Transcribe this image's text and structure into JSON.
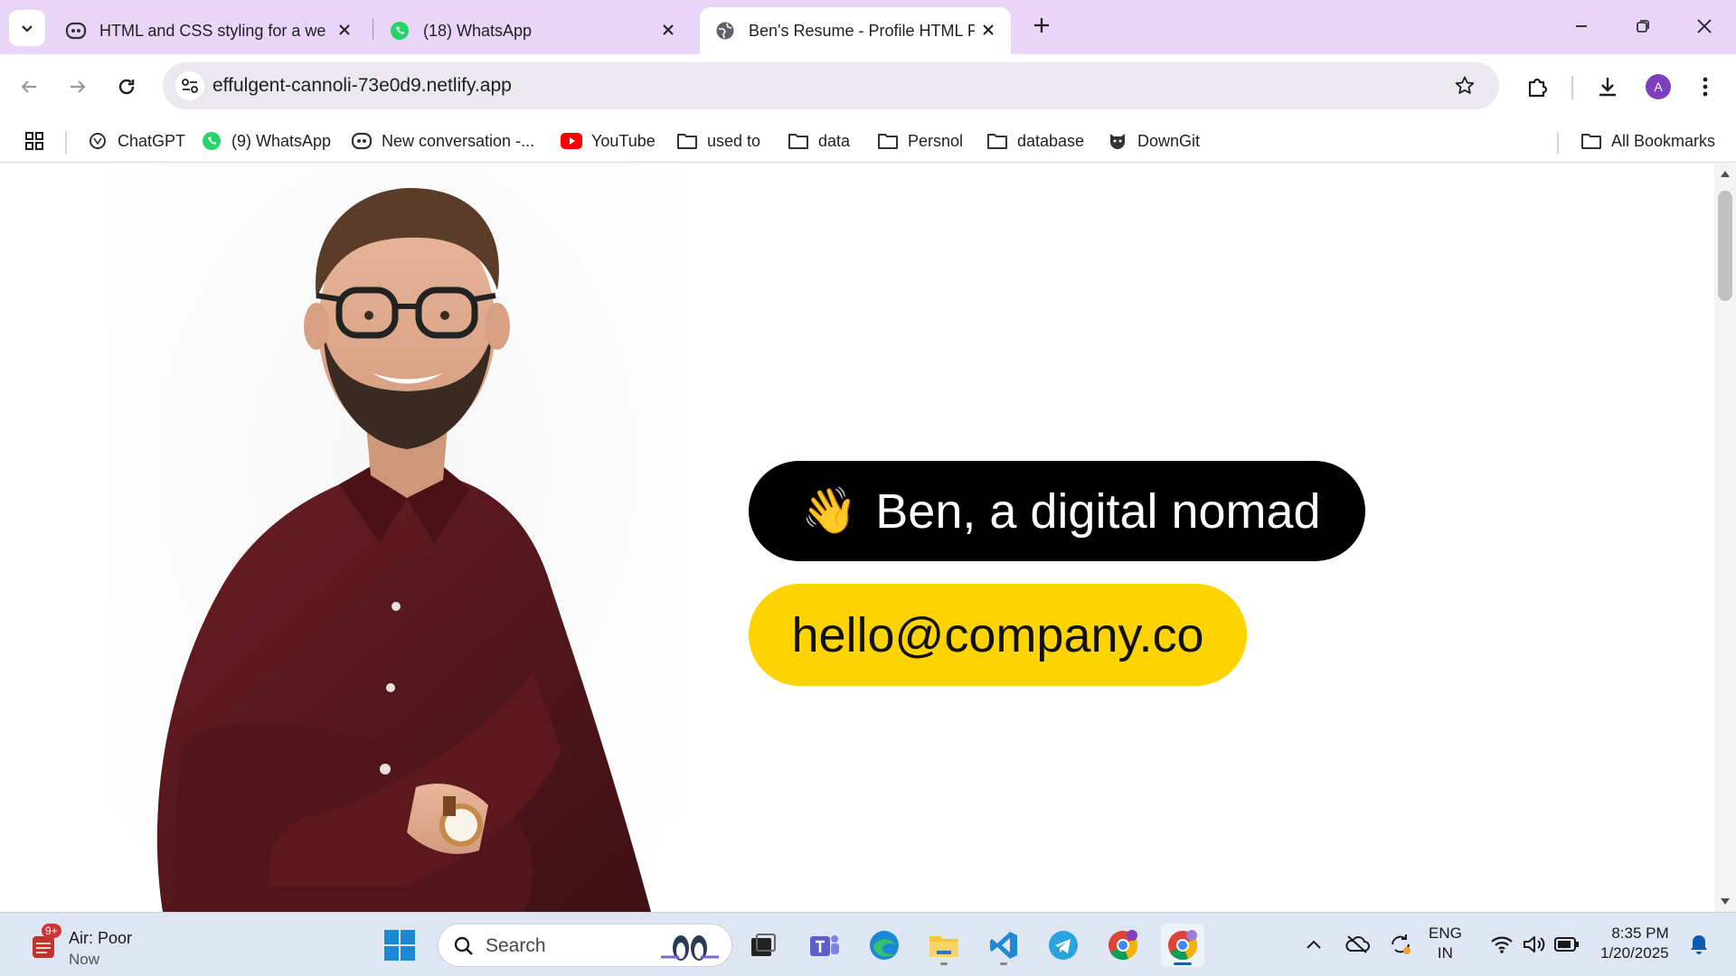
{
  "tabs": [
    {
      "title": "HTML and CSS styling for a web",
      "icon": "copilot-icon"
    },
    {
      "title": "(18) WhatsApp",
      "icon": "whatsapp-icon"
    },
    {
      "title": "Ben's Resume - Profile HTML Pa",
      "icon": "globe-icon",
      "active": true
    }
  ],
  "toolbar": {
    "url": "effulgent-cannoli-73e0d9.netlify.app",
    "avatar_initial": "A"
  },
  "bookmarks": {
    "items": [
      {
        "label": "ChatGPT",
        "icon": "chatgpt-icon"
      },
      {
        "label": "(9) WhatsApp",
        "icon": "whatsapp-icon"
      },
      {
        "label": "New conversation -...",
        "icon": "copilot-icon"
      },
      {
        "label": "YouTube",
        "icon": "youtube-icon"
      },
      {
        "label": "used to",
        "icon": "folder-icon"
      },
      {
        "label": "data",
        "icon": "folder-icon"
      },
      {
        "label": "Persnol",
        "icon": "folder-icon"
      },
      {
        "label": "database",
        "icon": "folder-icon"
      },
      {
        "label": "DownGit",
        "icon": "downgit-icon"
      }
    ],
    "all_bookmarks": "All Bookmarks"
  },
  "page": {
    "greeting_emoji": "👋",
    "name_line": "Ben, a digital nomad",
    "email": "hello@company.co",
    "colors": {
      "name_pill": "#000000",
      "email_pill": "#fdd400"
    }
  },
  "taskbar": {
    "weather_title": "Air: Poor",
    "weather_sub": "Now",
    "weather_badge": "9+",
    "search_placeholder": "Search",
    "lang_line1": "ENG",
    "lang_line2": "IN",
    "time": "8:35 PM",
    "date": "1/20/2025"
  }
}
